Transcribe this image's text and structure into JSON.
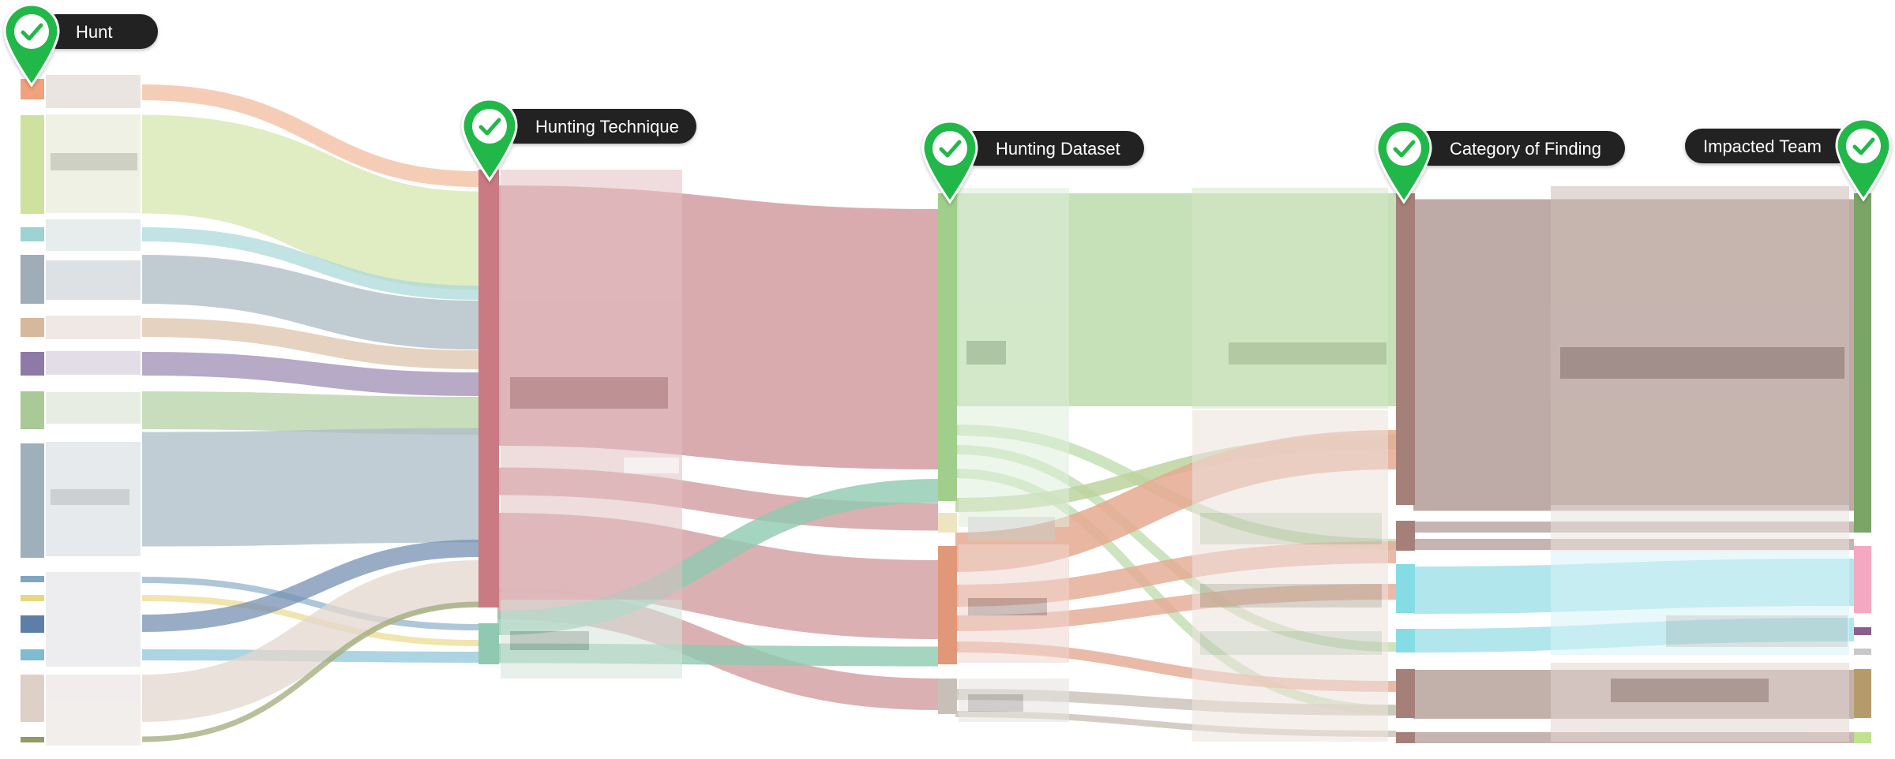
{
  "colors": {
    "badge_green": "#22b84a",
    "badge_pill": "#222222",
    "hunting_technique_node": "#c97a83",
    "hunting_technique_flow": "#d7a7aa",
    "dataset_green": "#9fcf8a",
    "dataset_flow_green": "#c3dfb4",
    "finding_node": "#a58078",
    "finding_flow": "#bba7a2",
    "team_node": "#7aa567",
    "cyan_flow": "#a9e4ea",
    "teal_flow": "#8fc9b1",
    "salmon_flow": "#e5a992"
  },
  "stages": [
    {
      "name": "stage-hunt",
      "label": "Hunt",
      "icon": "check-icon"
    },
    {
      "name": "stage-hunting-technique",
      "label": "Hunting Technique",
      "icon": "check-icon"
    },
    {
      "name": "stage-hunting-dataset",
      "label": "Hunting Dataset",
      "icon": "check-icon"
    },
    {
      "name": "stage-category-of-finding",
      "label": "Category of Finding",
      "icon": "check-icon"
    },
    {
      "name": "stage-impacted-team",
      "label": "Impacted Team",
      "icon": "check-icon"
    }
  ]
}
